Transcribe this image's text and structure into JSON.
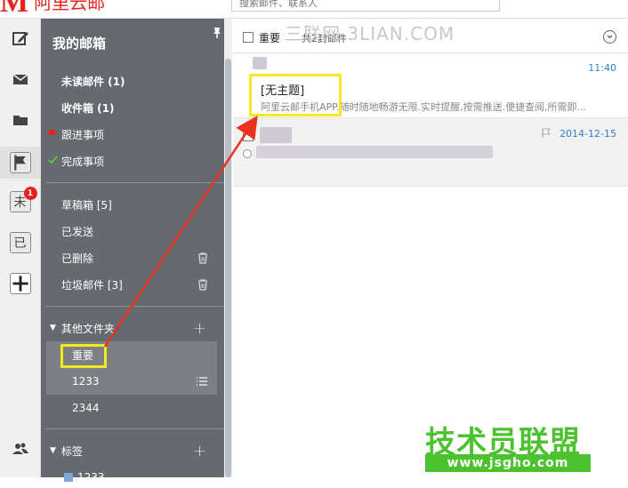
{
  "app": {
    "logo_text": "阿里云邮",
    "search_placeholder": "搜索邮件、联系人"
  },
  "sidebar": {
    "title": "我的邮箱",
    "items": [
      {
        "label": "未读邮件 (1)"
      },
      {
        "label": "收件箱 (1)"
      },
      {
        "label": "跟进事项"
      },
      {
        "label": "完成事项"
      },
      {
        "label": "草稿箱 [5]"
      },
      {
        "label": "已发送"
      },
      {
        "label": "已删除"
      },
      {
        "label": "垃圾邮件 [3]"
      }
    ],
    "other_folders": {
      "label": "其他文件夹",
      "folders": [
        "重要",
        "1233",
        "2344"
      ]
    },
    "tags": {
      "label": "标签",
      "items": [
        "1233"
      ]
    }
  },
  "iconbar": {
    "unread_label": "未",
    "unread_badge": "1",
    "read_label": "已"
  },
  "mail_list": {
    "folder_name": "重要",
    "count_text": "共2封邮件",
    "mails": [
      {
        "time": "11:40",
        "subject": "[无主题]",
        "preview": "阿里云邮手机APP.随时随地畅游无限.实时提醒,按需推送.便捷查阅,所需即..."
      },
      {
        "date": "2014-12-15"
      }
    ]
  },
  "watermarks": {
    "top": "三联网 3LIAN.COM",
    "brand": "技术员联盟",
    "url": "www.jsgho.com"
  },
  "colors": {
    "brand_red": "#e8231f",
    "sidebar_bg": "#646a70",
    "link_blue": "#2f7ec7",
    "highlight": "#f2ea21",
    "watermark_green": "#4cc22e"
  }
}
